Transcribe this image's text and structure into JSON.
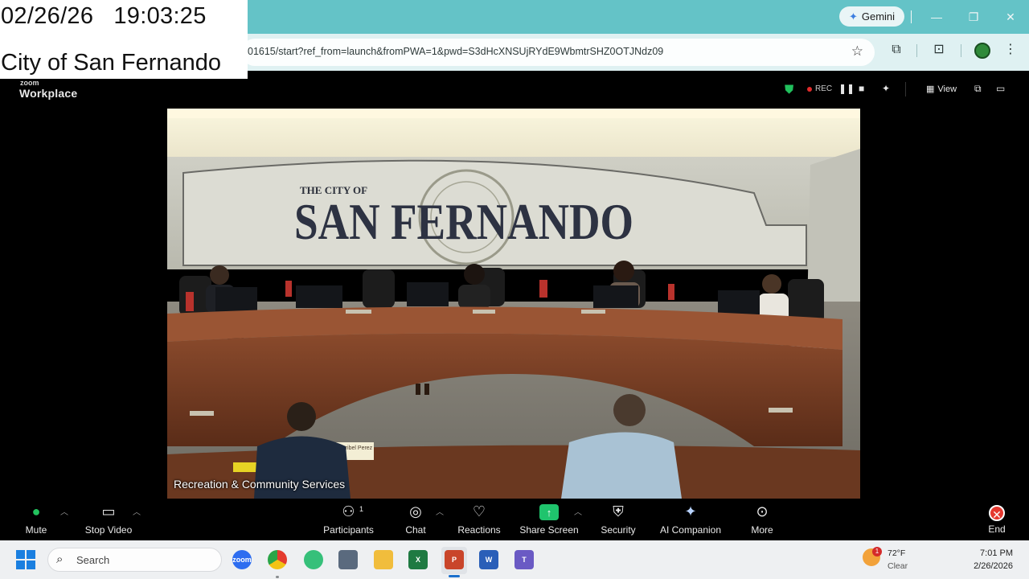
{
  "overlay": {
    "date": "02/26/26",
    "time": "19:03:25",
    "city": "City of San Fernando"
  },
  "browser": {
    "url": "01615/start?ref_from=launch&fromPWA=1&pwd=S3dHcXNSUjRYdE9WbmtrSHZ0OTJNdz09",
    "gemini_label": "Gemini"
  },
  "zoom": {
    "logo_small": "zoom",
    "logo": "Workplace",
    "rec_label": "REC",
    "view_label": "View",
    "video_label": "Recreation & Community Services",
    "participant_count": "1",
    "controls": {
      "mute": "Mute",
      "stop_video": "Stop Video",
      "participants": "Participants",
      "chat": "Chat",
      "reactions": "Reactions",
      "share_screen": "Share Screen",
      "security": "Security",
      "ai_companion": "AI Companion",
      "more": "More",
      "end": "End"
    }
  },
  "scene": {
    "wall_title_small": "THE CITY OF",
    "wall_title": "SAN FERNANDO",
    "seal_text": "CITY OF SAN FERNANDO · CALIFORNIA",
    "podium_label": "Maribel Perez"
  },
  "taskbar": {
    "search_placeholder": "Search",
    "zoom_app": "zoom",
    "weather_temp": "72°F",
    "weather_cond": "Clear",
    "weather_badge": "1",
    "clock_time": "7:01 PM",
    "clock_date": "2/26/2026"
  },
  "colors": {
    "titlebar": "#64c3c7",
    "toolbar": "#dff1f2",
    "zoom_bg": "#000000",
    "share_green": "#1fc46d",
    "end_red": "#e5382f",
    "taskbar": "#eef0f2"
  }
}
